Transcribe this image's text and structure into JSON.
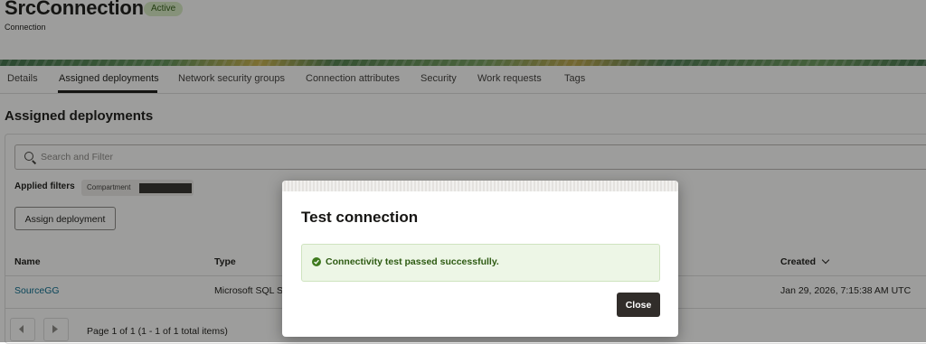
{
  "header": {
    "title": "SrcConnection",
    "status": "Active",
    "subtitle": "Connection"
  },
  "tabs": [
    {
      "label": "Details"
    },
    {
      "label": "Assigned deployments",
      "active": true
    },
    {
      "label": "Network security groups"
    },
    {
      "label": "Connection attributes"
    },
    {
      "label": "Security"
    },
    {
      "label": "Work requests"
    },
    {
      "label": "Tags"
    }
  ],
  "section": {
    "title": "Assigned deployments"
  },
  "search": {
    "placeholder": "Search and Filter",
    "icon": "search-icon"
  },
  "filters": {
    "label": "Applied filters",
    "chip_label": "Compartment"
  },
  "assign_button": "Assign deployment",
  "table": {
    "columns": [
      "Name",
      "Type",
      "Created"
    ],
    "rows": [
      {
        "name": "SourceGG",
        "type": "Microsoft SQL Se",
        "created": "Jan 29, 2026, 7:15:38 AM UTC"
      }
    ]
  },
  "pagination": {
    "text": "Page 1 of 1 (1 - 1 of 1 total items)"
  },
  "dialog": {
    "title": "Test connection",
    "message": "Connectivity test passed successfully.",
    "close_label": "Close"
  },
  "colors": {
    "success": "#3f7a1e",
    "link": "#00688c",
    "primary_button": "#312d2a"
  }
}
